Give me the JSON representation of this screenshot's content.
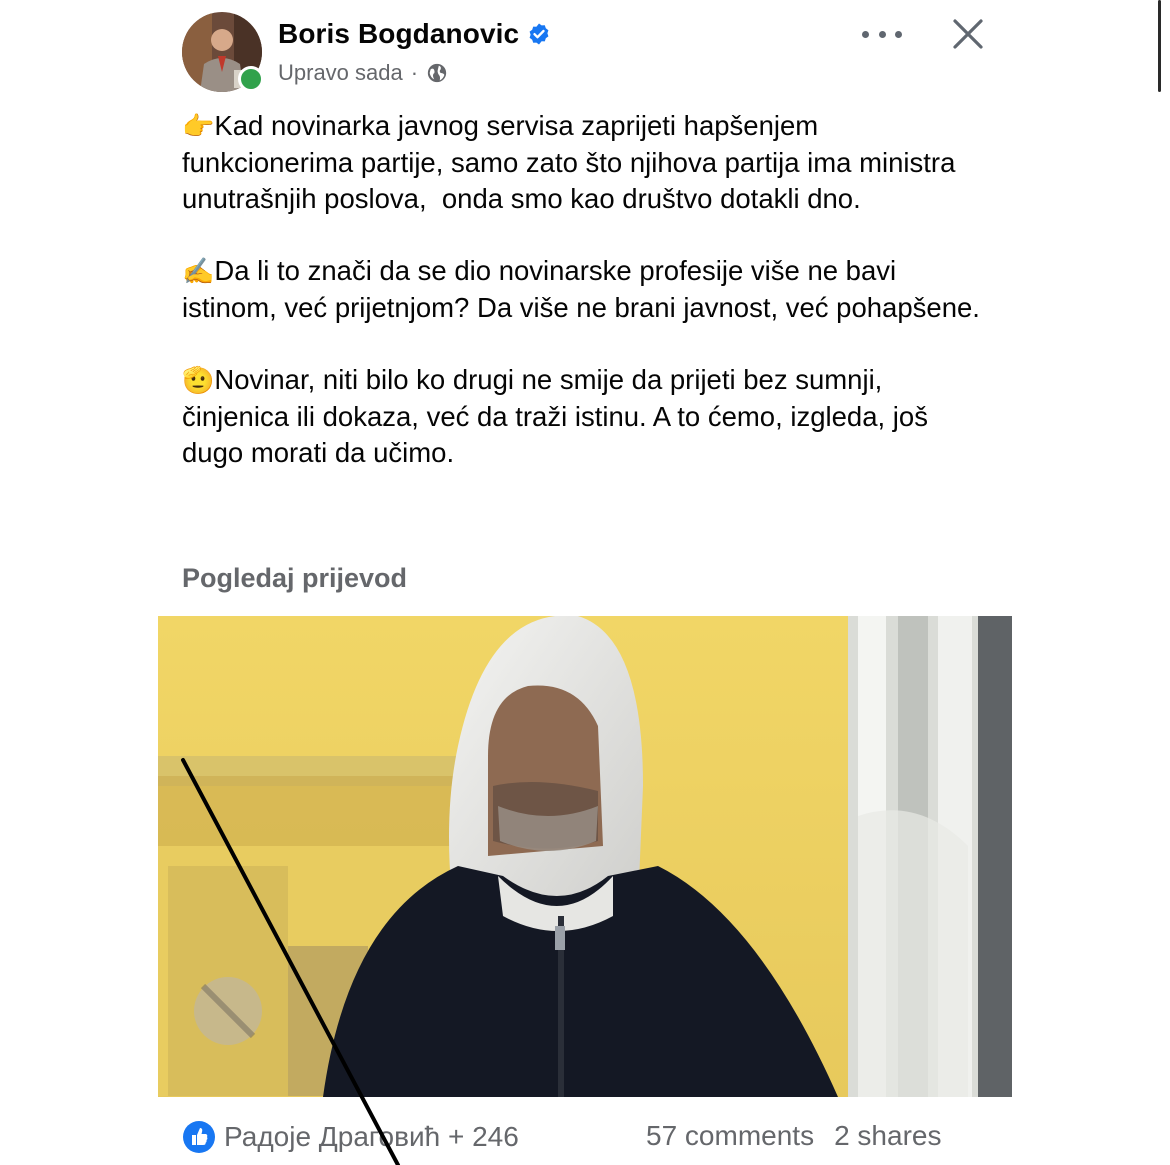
{
  "post": {
    "author": "Boris Bogdanovic",
    "timestamp": "Upravo sada",
    "separator": "·",
    "audience_icon": "globe-icon",
    "verified_icon": "verified-badge-icon",
    "paragraphs": [
      {
        "emoji": "👉",
        "text": "Kad novinarka javnog servisa zaprijeti hapšenjem funkcionerima partije, samo zato što njihova partija ima ministra unutrašnjih poslova,  onda smo kao društvo dotakli dno."
      },
      {
        "emoji": "✍️",
        "text": "Da li to znači da se dio novinarske profesije više ne bavi istinom, već prijetnjom? Da više ne brani javnost, već pohapšene."
      },
      {
        "emoji": "🫡",
        "text": "Novinar, niti bilo ko drugi ne smije da prijeti bez sumnji, činjenica ili dokaza, već da traži istinu. A to ćemo, izgleda, još dugo morati da učimo."
      }
    ],
    "see_translation": "Pogledaj prijevod"
  },
  "footer": {
    "reaction_icon": "like-icon",
    "reactors": "Радоје Драговић + 246",
    "comments": "57 comments",
    "shares": "2 shares"
  },
  "colors": {
    "verified": "#1877f2",
    "secondary_text": "#65676b",
    "online": "#31a24c",
    "image_background": "#f3da63"
  }
}
